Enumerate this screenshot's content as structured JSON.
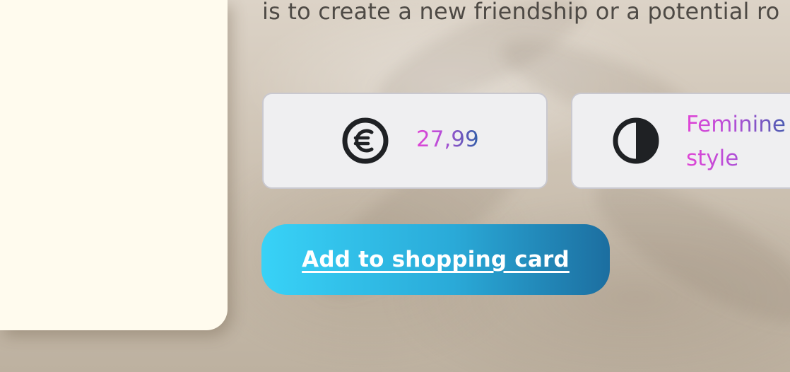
{
  "description": {
    "text": "is to create a new friendship or a potential ro"
  },
  "price": {
    "icon": "euro-icon",
    "value": "27,99"
  },
  "style": {
    "icon": "contrast-icon",
    "value": "Feminine style"
  },
  "cta": {
    "label": "Add to shopping card"
  },
  "colors": {
    "card_background": "#fffbee",
    "info_box_background": "#efeff1",
    "info_box_border": "#c9c8cf",
    "text_gradient_start": "#e045d6",
    "text_gradient_end": "#2f5fa8",
    "button_gradient_start": "#38d2f7",
    "button_gradient_end": "#1c6ea0",
    "body_text": "#4e4a45"
  }
}
